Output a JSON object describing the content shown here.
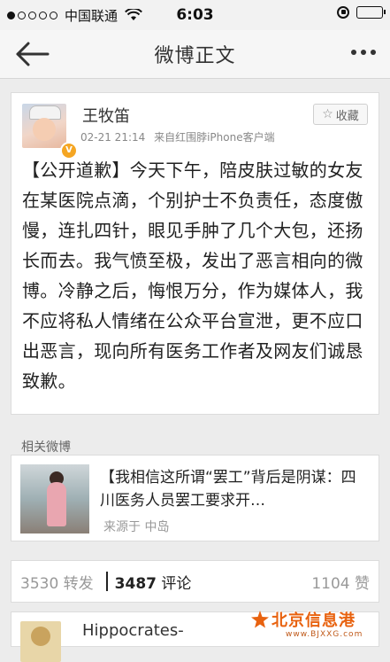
{
  "status_bar": {
    "carrier": "中国联通",
    "time": "6:03"
  },
  "nav": {
    "title": "微博正文"
  },
  "post": {
    "author": "王牧笛",
    "time": "02-21 21:14",
    "source": "来自红围脖iPhone客户端",
    "favorite_label": "收藏",
    "verified_badge": "V",
    "text": "【公开道歉】今天下午，陪皮肤过敏的女友在某医院点滴，个别护士不负责任，态度傲慢，连扎四针，眼见手肿了几个大包，还扬长而去。我气愤至极，发出了恶言相向的微博。冷静之后，悔恨万分，作为媒体人，我不应将私人情绪在公众平台宣泄，更不应口出恶言，现向所有医务工作者及网友们诚恳致歉。"
  },
  "related": {
    "section_title": "相关微博",
    "text": "【我相信这所谓“罢工”背后是阴谋：四川医务人员罢工要求开…",
    "source": "来源于 中岛"
  },
  "actions": {
    "repost_count": "3530",
    "repost_label": "转发",
    "comment_count": "3487",
    "comment_label": "评论",
    "like_count": "1104",
    "like_label": "赞"
  },
  "comment": {
    "user": "Hippocrates-"
  },
  "watermark": {
    "name": "北京信息港",
    "url": "www.BJXXG.com"
  },
  "colors": {
    "verified_badge": "#f5a623",
    "watermark": "#e8620f"
  }
}
